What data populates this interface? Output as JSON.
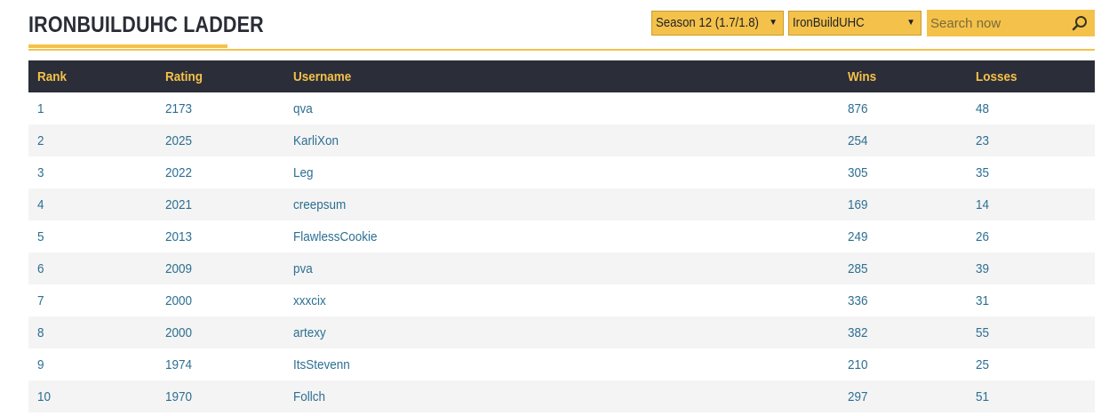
{
  "header": {
    "title": "IRONBUILDUHC LADDER",
    "season_select": "Season 12 (1.7/1.8)",
    "ladder_select": "IronBuildUHC",
    "search_placeholder": "Search now",
    "caret_glyph": "▼"
  },
  "colors": {
    "accent": "#f4c24a",
    "header_bg": "#2b2d38",
    "link": "#2d6f92",
    "row_alt": "#f4f4f4"
  },
  "table": {
    "columns": [
      "Rank",
      "Rating",
      "Username",
      "Wins",
      "Losses"
    ],
    "rows": [
      [
        "1",
        "2173",
        "qva",
        "876",
        "48"
      ],
      [
        "2",
        "2025",
        "KarliXon",
        "254",
        "23"
      ],
      [
        "3",
        "2022",
        "Leg",
        "305",
        "35"
      ],
      [
        "4",
        "2021",
        "creepsum",
        "169",
        "14"
      ],
      [
        "5",
        "2013",
        "FlawlessCookie",
        "249",
        "26"
      ],
      [
        "6",
        "2009",
        "pva",
        "285",
        "39"
      ],
      [
        "7",
        "2000",
        "xxxcix",
        "336",
        "31"
      ],
      [
        "8",
        "2000",
        "artexy",
        "382",
        "55"
      ],
      [
        "9",
        "1974",
        "ItsStevenn",
        "210",
        "25"
      ],
      [
        "10",
        "1970",
        "Follch",
        "297",
        "51"
      ]
    ]
  }
}
